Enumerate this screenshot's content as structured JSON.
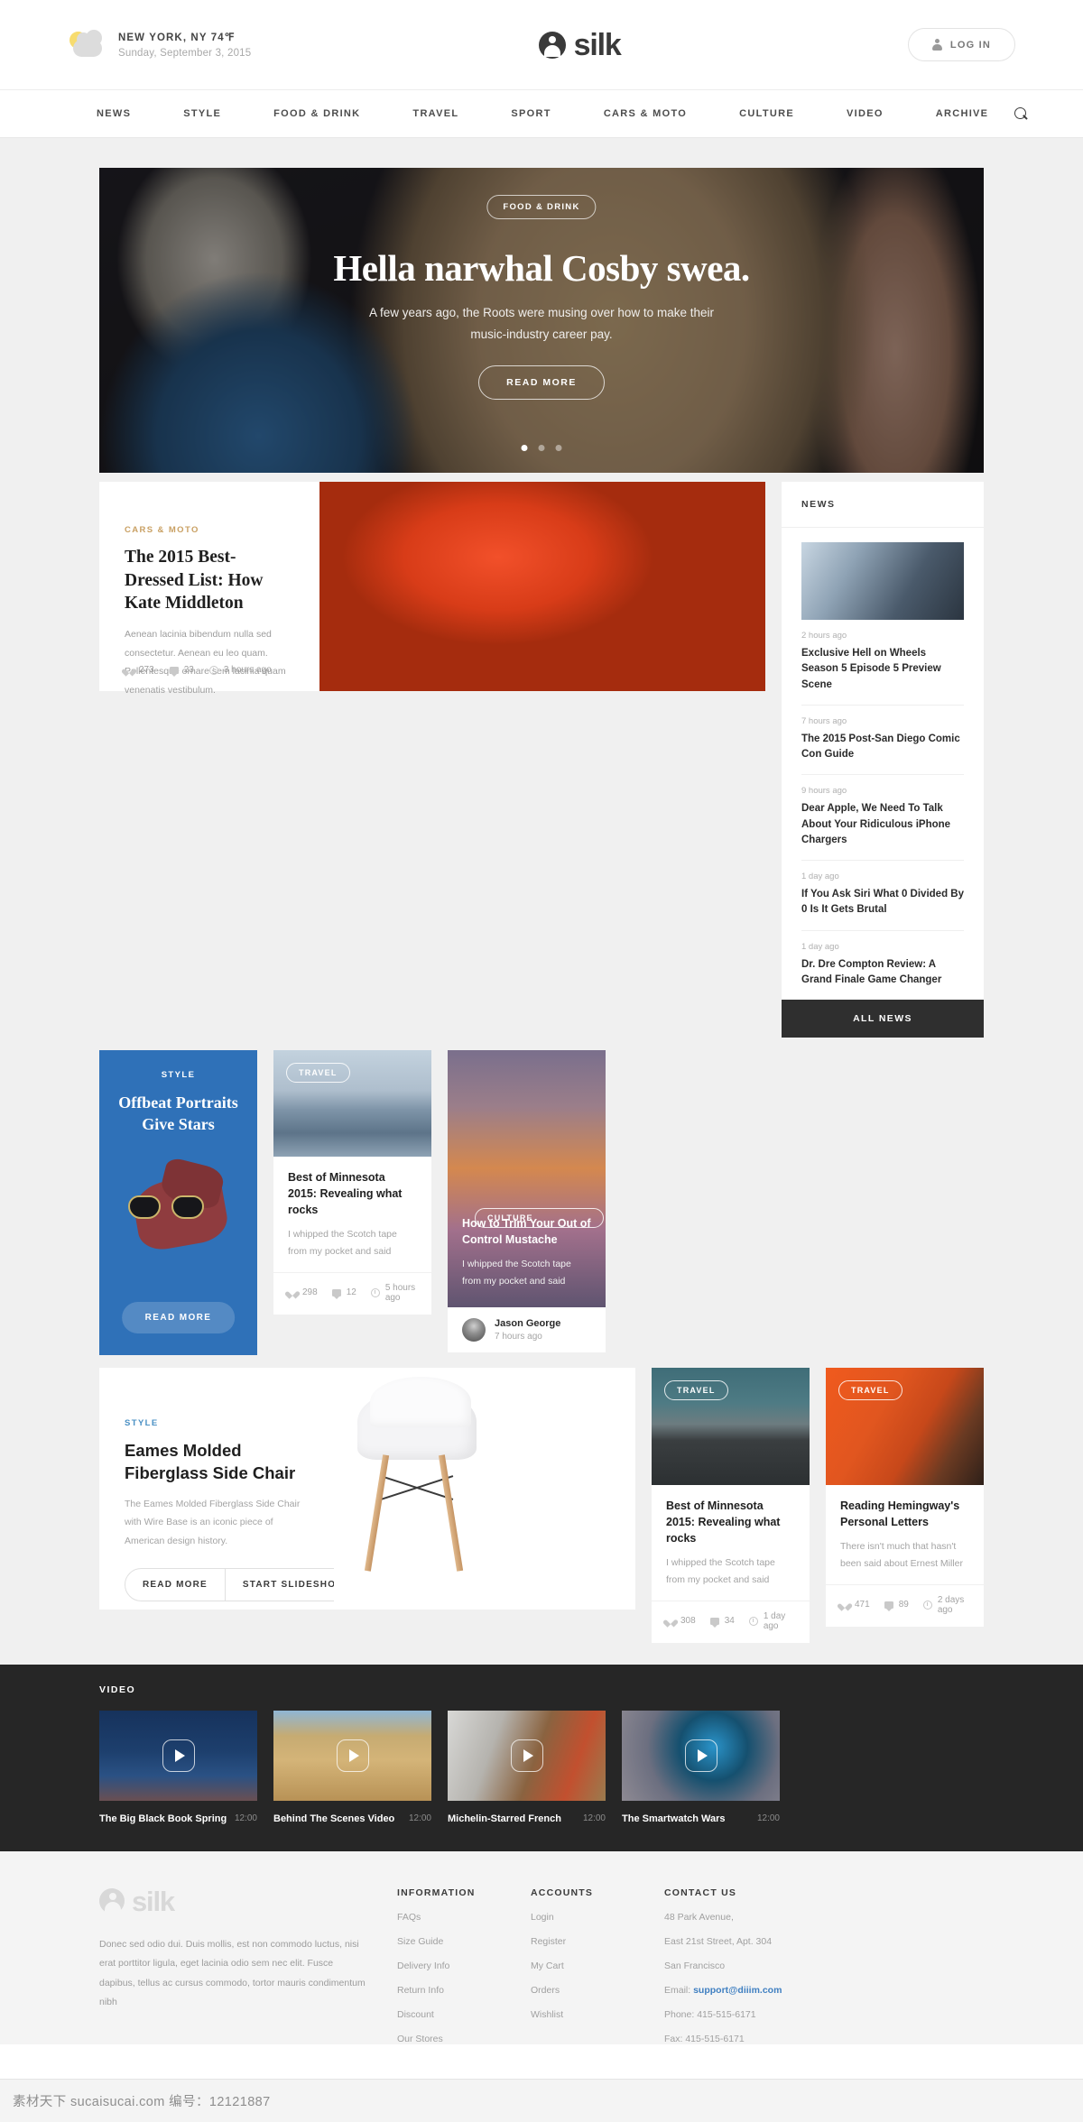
{
  "header": {
    "weather": {
      "location_temp": "NEW YORK, NY  74℉",
      "date": "Sunday, September 3, 2015"
    },
    "logo": "silk",
    "login_label": "LOG IN"
  },
  "nav": {
    "items": [
      "NEWS",
      "STYLE",
      "FOOD & DRINK",
      "TRAVEL",
      "SPORT",
      "CARS & MOTO",
      "CULTURE",
      "VIDEO",
      "ARCHIVE"
    ]
  },
  "hero": {
    "badge": "FOOD & DRINK",
    "title": "Hella narwhal Cosby swea.",
    "subtitle": "A few years ago, the Roots were musing over how to make their music-industry career pay.",
    "button": "READ MORE",
    "dots": 3,
    "active_dot": 1
  },
  "feature": {
    "category": "CARS & MOTO",
    "title": "The 2015 Best-Dressed List: How Kate Middleton",
    "excerpt": "Aenean lacinia bibendum nulla sed consectetur. Aenean eu leo quam. Pellentesque ornare sem lacinia quam venenatis vestibulum.",
    "likes": "273",
    "comments": "23",
    "time": "3 hours ago"
  },
  "news": {
    "heading": "NEWS",
    "all_label": "ALL NEWS",
    "items": [
      {
        "time": "2 hours ago",
        "title": "Exclusive Hell on Wheels Season 5 Episode 5 Preview Scene"
      },
      {
        "time": "7 hours ago",
        "title": "The 2015 Post-San Diego Comic Con Guide"
      },
      {
        "time": "9 hours ago",
        "title": "Dear Apple, We Need To Talk About Your Ridiculous iPhone Chargers"
      },
      {
        "time": "1 day ago",
        "title": "If You Ask Siri What 0 Divided By 0 Is It Gets Brutal"
      },
      {
        "time": "1 day ago",
        "title": "Dr. Dre Compton Review: A Grand Finale Game Changer"
      }
    ]
  },
  "promo": {
    "category": "STYLE",
    "title": "Offbeat Portraits Give Stars",
    "button": "READ MORE",
    "color": "#2f71b8"
  },
  "card_minnesota_1": {
    "pill": "TRAVEL",
    "title": "Best of Minnesota 2015: Revealing what rocks",
    "excerpt": "I whipped the Scotch tape from my pocket and said",
    "likes": "298",
    "comments": "12",
    "time": "5 hours ago"
  },
  "card_mustache": {
    "pill": "CULTURE",
    "title": "How to Trim Your Out of Control Mustache",
    "excerpt": "I whipped the Scotch tape from my pocket and said",
    "author": "Jason George",
    "time": "7 hours ago"
  },
  "eames": {
    "category": "STYLE",
    "title": "Eames Molded Fiberglass Side Chair",
    "excerpt": "The Eames Molded Fiberglass Side Chair with Wire Base is an iconic piece of American design history.",
    "button_read": "READ MORE",
    "button_slideshow": "START SLIDESHOW"
  },
  "card_minnesota_2": {
    "pill": "TRAVEL",
    "title": "Best of Minnesota 2015: Revealing what rocks",
    "excerpt": "I whipped the Scotch tape from my pocket and said",
    "likes": "308",
    "comments": "34",
    "time": "1 day ago"
  },
  "card_hemingway": {
    "pill": "TRAVEL",
    "title": "Reading Hemingway's Personal Letters",
    "excerpt": "There isn't much that hasn't been said about Ernest Miller",
    "likes": "471",
    "comments": "89",
    "time": "2 days ago"
  },
  "video": {
    "heading": "VIDEO",
    "items": [
      {
        "title": "The Big Black Book Spring",
        "duration": "12:00"
      },
      {
        "title": "Behind The Scenes Video",
        "duration": "12:00"
      },
      {
        "title": "Michelin-Starred French",
        "duration": "12:00"
      },
      {
        "title": "The Smartwatch Wars",
        "duration": "12:00"
      }
    ]
  },
  "footer": {
    "logo": "silk",
    "about": "Donec sed odio dui. Duis mollis, est non commodo luctus, nisi erat porttitor ligula, eget lacinia odio sem nec elit. Fusce dapibus, tellus ac cursus commodo, tortor mauris condimentum nibh",
    "information": {
      "title": "INFORMATION",
      "links": [
        "FAQs",
        "Size Guide",
        "Delivery Info",
        "Return Info",
        "Discount",
        "Our Stores"
      ]
    },
    "accounts": {
      "title": "ACCOUNTS",
      "links": [
        "Login",
        "Register",
        "My Cart",
        "Orders",
        "Wishlist"
      ]
    },
    "contact": {
      "title": "CONTACT US",
      "address1": "48 Park Avenue,",
      "address2": "East 21st Street, Apt. 304",
      "address3": "San Francisco",
      "email_label": "Email: ",
      "email": "support@diiim.com",
      "phone": "Phone: 415-515-6171",
      "fax": "Fax: 415-515-6171"
    }
  },
  "watermark": "素材天下 sucaisucai.com 编号：12121887"
}
